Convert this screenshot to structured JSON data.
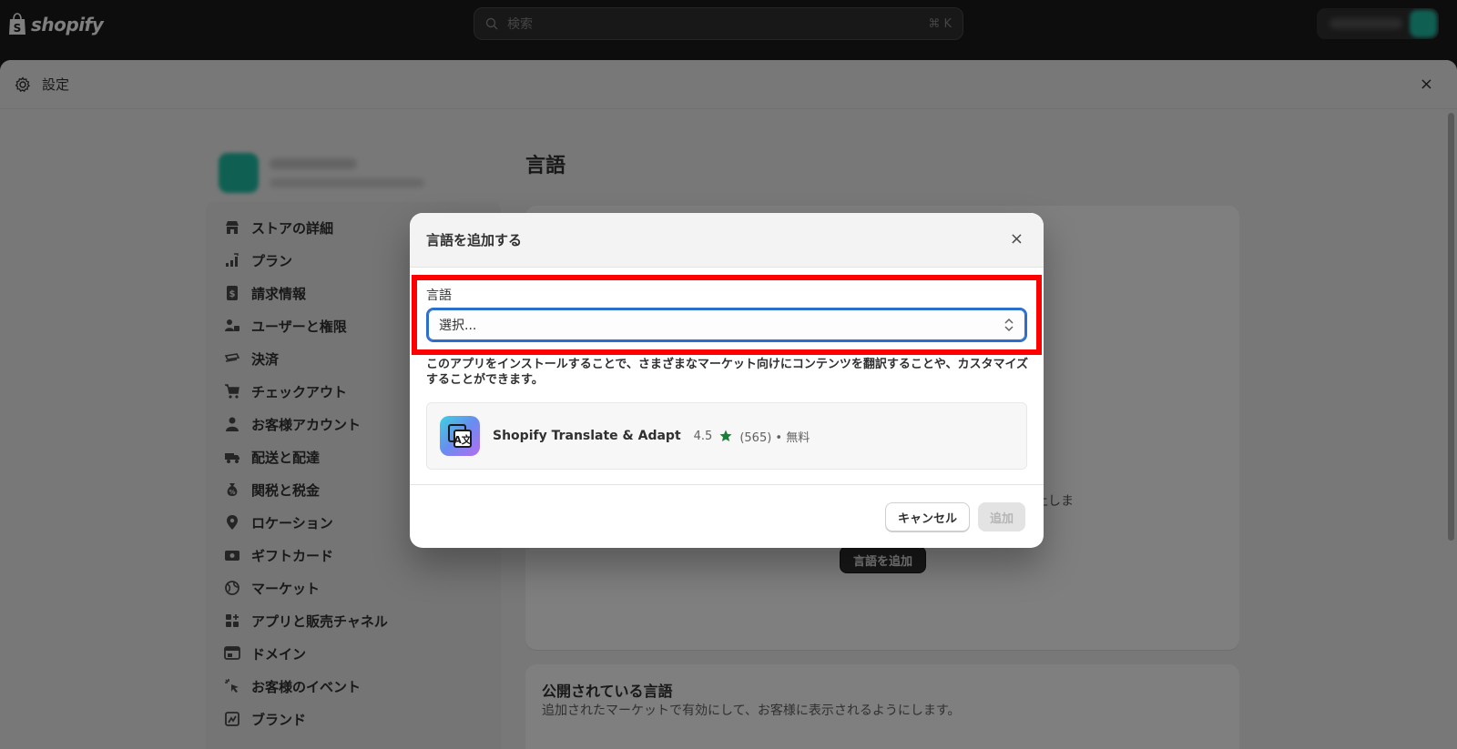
{
  "topbar": {
    "logo_text": "shopify",
    "search_placeholder": "検索",
    "search_shortcut": "⌘ K"
  },
  "settings": {
    "title": "設定",
    "close_glyph": "×"
  },
  "sidebar": {
    "items": [
      {
        "label": "ストアの詳細",
        "icon": "store-icon"
      },
      {
        "label": "プラン",
        "icon": "plan-chart-icon"
      },
      {
        "label": "請求情報",
        "icon": "billing-icon"
      },
      {
        "label": "ユーザーと権限",
        "icon": "users-icon"
      },
      {
        "label": "決済",
        "icon": "payment-icon"
      },
      {
        "label": "チェックアウト",
        "icon": "cart-icon"
      },
      {
        "label": "お客様アカウント",
        "icon": "person-icon"
      },
      {
        "label": "配送と配達",
        "icon": "truck-icon"
      },
      {
        "label": "関税と税金",
        "icon": "tax-bag-icon"
      },
      {
        "label": "ロケーション",
        "icon": "location-pin-icon"
      },
      {
        "label": "ギフトカード",
        "icon": "gift-card-icon"
      },
      {
        "label": "マーケット",
        "icon": "globe-icon"
      },
      {
        "label": "アプリと販売チャネル",
        "icon": "apps-icon"
      },
      {
        "label": "ドメイン",
        "icon": "domain-icon"
      },
      {
        "label": "お客様のイベント",
        "icon": "cursor-click-icon"
      },
      {
        "label": "ブランド",
        "icon": "brand-icon"
      }
    ]
  },
  "main": {
    "title": "言語",
    "card1_desc_fragment": "上しま",
    "card1_button": "言語を追加",
    "card2_title": "公開されている言語",
    "card2_desc": "追加されたマーケットで有効にして、お客様に表示されるようにします。"
  },
  "modal": {
    "title": "言語を追加する",
    "close_glyph": "×",
    "field_label": "言語",
    "select_value": "選択...",
    "help_text": "このアプリをインストールすることで、さまざまなマーケット向けにコンテンツを翻訳することや、カスタマイズすることができます。",
    "app": {
      "name": "Shopify Translate & Adapt",
      "rating": "4.5",
      "reviews": "(565) • 無料"
    },
    "cancel_label": "キャンセル",
    "add_label": "追加"
  },
  "colors": {
    "highlight": "#ff0000",
    "focus": "#2c6ecb",
    "star": "#1a7f37",
    "brand_teal": "#1fbfa5"
  }
}
